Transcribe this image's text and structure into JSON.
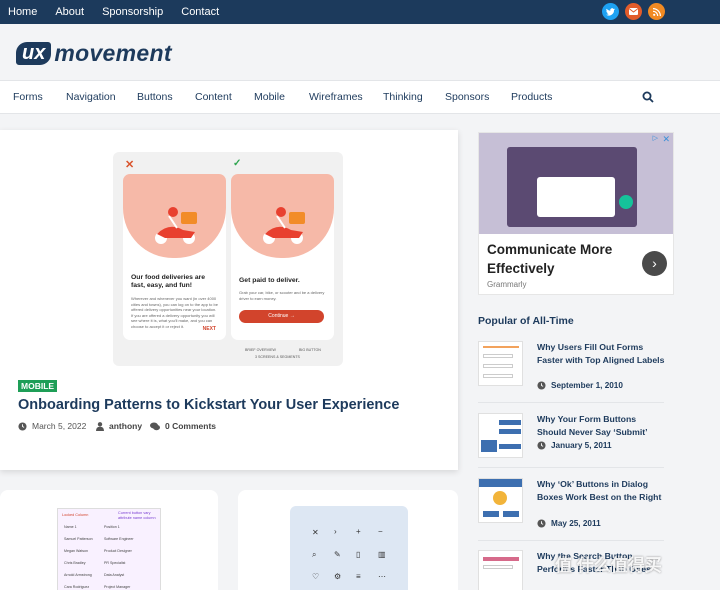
{
  "topbar": {
    "links": [
      "Home",
      "About",
      "Sponsorship",
      "Contact"
    ],
    "social": [
      {
        "icon": "twitter-icon",
        "color": "#1da1f2"
      },
      {
        "icon": "mail-icon",
        "color": "#e25c2b"
      },
      {
        "icon": "rss-icon",
        "color": "#f18a23"
      }
    ]
  },
  "logo": {
    "ux": "ux",
    "word": "movement"
  },
  "nav": {
    "items": [
      "Forms",
      "Navigation",
      "Buttons",
      "Content",
      "Mobile",
      "Wireframes",
      "Thinking",
      "Sponsors",
      "Products"
    ],
    "search_icon": "search-icon"
  },
  "featured": {
    "category": "MOBILE",
    "title": "Onboarding Patterns to Kickstart Your User Experience",
    "date": "March 5, 2022",
    "author": "anthony",
    "comments": "0 Comments",
    "image": {
      "left_heading": "Our food deliveries are fast, easy, and fun!",
      "left_body": "Wherever and whenever you want (in over 4000 cities and towns), you can log on to the app to be offered delivery opportunities near your location. If you are offered a delivery opportunity you will see where it is, what you'll make, and you can choose to accept it or reject it.",
      "next_label": "NEXT",
      "right_heading": "Get paid to deliver.",
      "right_body": "Grab your car, bike, or scooter and be a delivery driver to earn money.",
      "continue_label": "Continue →",
      "anno_left": "BRIEF OVERVIEW",
      "anno_mid": "3 SCREENS & SEGMENTS",
      "anno_right": "BIG BUTTON"
    }
  },
  "ad": {
    "title": "Communicate More Effectively",
    "sponsor": "Grammarly",
    "accent": "#4a4a4a"
  },
  "popular": {
    "heading": "Popular of All-Time",
    "items": [
      {
        "title": "Why Users Fill Out Forms Faster with Top Aligned Labels",
        "date": "September 1, 2010"
      },
      {
        "title": "Why Your Form Buttons Should Never Say ‘Submit’",
        "date": "January 5, 2011"
      },
      {
        "title": "Why ‘Ok’ Buttons in Dialog Boxes Work Best on the Right",
        "date": "May 25, 2011"
      },
      {
        "title": "Why the Search Button Performs Faster Than Ones",
        "date": ""
      }
    ]
  },
  "lower_cards": {
    "table_header": "Locked Column",
    "table_note": "Current button vary attribute name column",
    "rows": [
      "Name 1",
      "Samuel Patterson",
      "Megan Watson",
      "Chris Bradley",
      "Arnold Armstrong",
      "Cara Rodriguez"
    ],
    "roles": [
      "Position 1",
      "Software Engineer",
      "Product Designer",
      "PR Specialist",
      "Data Analyst",
      "Project Manager"
    ]
  },
  "watermark": "值 什么值得买"
}
